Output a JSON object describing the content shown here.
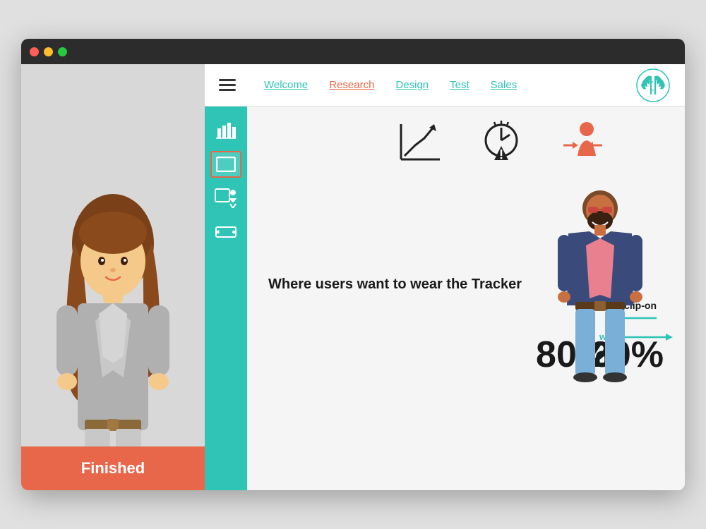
{
  "browser": {
    "traffic_lights": [
      "red",
      "yellow",
      "green"
    ]
  },
  "nav": {
    "links": [
      {
        "label": "Welcome",
        "active": false
      },
      {
        "label": "Research",
        "active": true
      },
      {
        "label": "Design",
        "active": false
      },
      {
        "label": "Test",
        "active": false
      },
      {
        "label": "Sales",
        "active": false
      }
    ]
  },
  "sidebar_icons": [
    {
      "name": "bar-chart-icon",
      "symbol": "▦",
      "active": false
    },
    {
      "name": "rectangle-icon",
      "symbol": "▭",
      "active": true
    },
    {
      "name": "person-slide-icon",
      "symbol": "▣",
      "active": false
    },
    {
      "name": "resize-icon",
      "symbol": "⊟",
      "active": false
    }
  ],
  "content": {
    "title": "Where users want to wear the Tracker",
    "percent_wrist": "80%",
    "percent_clip": "20%",
    "label_wrist": "wrist",
    "label_clip": "clip-on",
    "finished_label": "Finished"
  }
}
